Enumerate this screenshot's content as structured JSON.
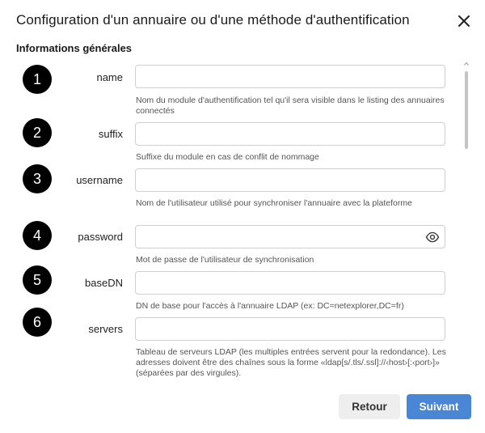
{
  "dialog": {
    "title": "Configuration d'un annuaire ou d'une méthode d'authentification",
    "section_title": "Informations générales"
  },
  "fields": [
    {
      "number": "1",
      "label": "name",
      "value": "",
      "help": "Nom du module d'authentification tel qu'il sera visible dans le listing des annuaires connectés"
    },
    {
      "number": "2",
      "label": "suffix",
      "value": "",
      "help": "Suffixe du module en cas de conflit de nommage"
    },
    {
      "number": "3",
      "label": "username",
      "value": "",
      "help": "Nom de l'utilisateur utilisé pour synchroniser l'annuaire avec la plateforme"
    },
    {
      "number": "4",
      "label": "password",
      "value": "",
      "help": "Mot de passe de l'utilisateur de synchronisation"
    },
    {
      "number": "5",
      "label": "baseDN",
      "value": "",
      "help": "DN de base pour l'accès à l'annuaire LDAP (ex: DC=netexplorer,DC=fr)"
    },
    {
      "number": "6",
      "label": "servers",
      "value": "",
      "help": "Tableau de serveurs LDAP (les multiples entrées servent pour la redondance). Les adresses doivent être des chaînes sous la forme «ldap[s/.tls/.ssl]://‹host›[:‹port›]» (séparées par des virgules)."
    }
  ],
  "buttons": {
    "back_label": "Retour",
    "next_label": "Suivant"
  },
  "colors": {
    "primary": "#4a86d6",
    "secondary_bg": "#eeeeee",
    "badge_bg": "#000000"
  },
  "icons": {
    "close": "close-icon",
    "password_toggle": "eye-icon",
    "scroll_up": "chevron-up-icon"
  }
}
